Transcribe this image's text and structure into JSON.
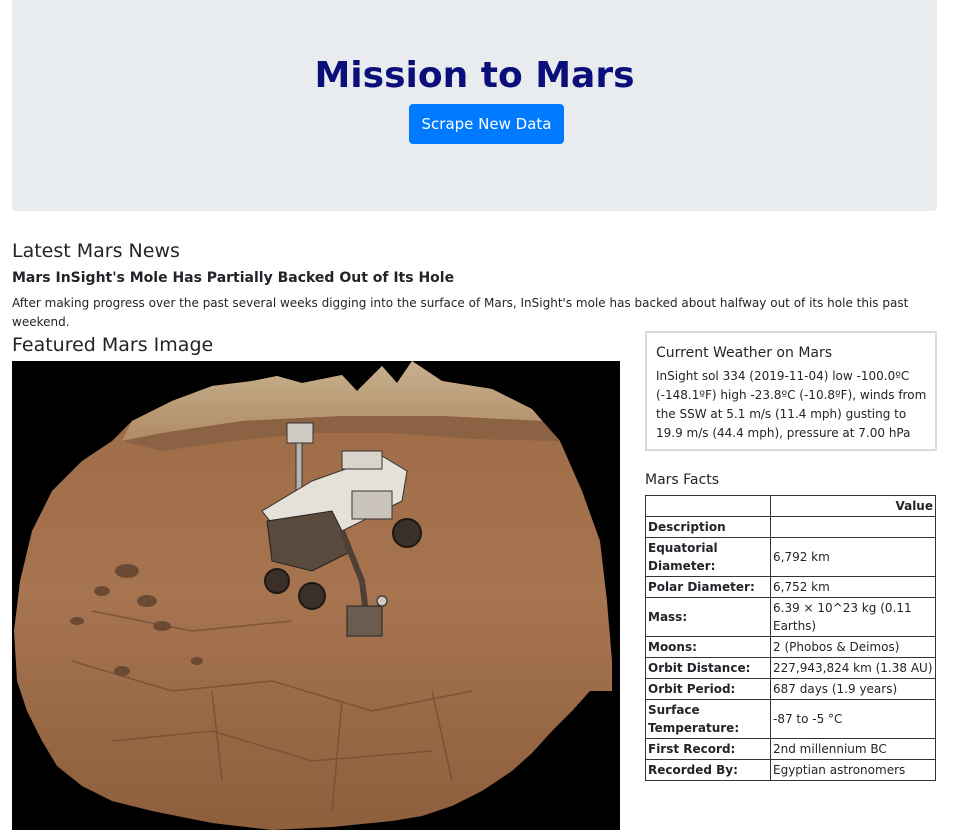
{
  "header": {
    "title": "Mission to Mars",
    "scrape_button_label": "Scrape New Data"
  },
  "news": {
    "section_heading": "Latest Mars News",
    "title": "Mars InSight's Mole Has Partially Backed Out of Its Hole",
    "paragraph": "After making progress over the past several weeks digging into the surface of Mars, InSight's mole has backed about halfway out of its hole this past weekend."
  },
  "featured": {
    "heading": "Featured Mars Image"
  },
  "weather": {
    "heading": "Current Weather on Mars",
    "text": "InSight sol 334 (2019-11-04) low -100.0ºC (-148.1ºF) high -23.8ºC (-10.8ºF), winds from the SSW at 5.1 m/s (11.4 mph) gusting to 19.9 m/s (44.4 mph), pressure at 7.00 hPa"
  },
  "facts": {
    "heading": "Mars Facts",
    "header_blank": "",
    "header_value": "Value",
    "rows": [
      {
        "label": "Description",
        "value": ""
      },
      {
        "label": "Equatorial Diameter:",
        "value": "6,792 km"
      },
      {
        "label": "Polar Diameter:",
        "value": "6,752 km"
      },
      {
        "label": "Mass:",
        "value": "6.39 × 10^23 kg (0.11 Earths)"
      },
      {
        "label": "Moons:",
        "value": "2 (Phobos & Deimos)"
      },
      {
        "label": "Orbit Distance:",
        "value": "227,943,824 km (1.38 AU)"
      },
      {
        "label": "Orbit Period:",
        "value": "687 days (1.9 years)"
      },
      {
        "label": "Surface Temperature:",
        "value": "-87 to -5 °C"
      },
      {
        "label": "First Record:",
        "value": "2nd millennium BC"
      },
      {
        "label": "Recorded By:",
        "value": "Egyptian astronomers"
      }
    ]
  },
  "colors": {
    "title": "#0b0f7a",
    "button": "#007bff",
    "jumbotron": "#e9ecef"
  }
}
